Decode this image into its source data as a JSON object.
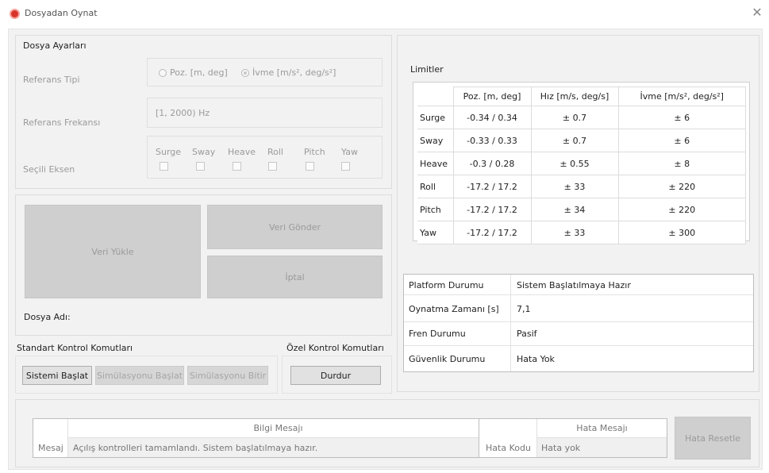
{
  "window": {
    "title": "Dosyadan Oynat",
    "close_glyph": "✕"
  },
  "file_settings": {
    "title": "Dosya Ayarları",
    "reference_type": {
      "label": "Referans Tipi",
      "option_1": "Poz. [m, deg]",
      "option_2": "İvme  [m/s², deg/s²]",
      "selected": "option_2"
    },
    "reference_freq": {
      "label": "Referans Frekansı",
      "value": "[1, 2000) Hz"
    },
    "selected_axis": {
      "label": "Seçili Eksen",
      "axes": [
        "Surge",
        "Sway",
        "Heave",
        "Roll",
        "Pitch",
        "Yaw"
      ]
    }
  },
  "actions": {
    "load": "Veri Yükle",
    "send": "Veri Gönder",
    "cancel": "İptal",
    "file_name_label": "Dosya Adı:"
  },
  "std_commands": {
    "title": "Standart Kontrol Komutları",
    "start_system": "Sistemi Başlat",
    "start_sim": "Simülasyonu Başlat",
    "end_sim": "Simülasyonu Bitir"
  },
  "special_commands": {
    "title": "Özel Kontrol Komutları",
    "stop": "Durdur"
  },
  "limits": {
    "title": "Limitler",
    "headers": [
      "Poz. [m, deg]",
      "Hız [m/s, deg/s]",
      "İvme [m/s², deg/s²]"
    ],
    "rows": [
      {
        "axis": "Surge",
        "pos": "-0.34 / 0.34",
        "vel": "± 0.7",
        "acc": "± 6"
      },
      {
        "axis": "Sway",
        "pos": "-0.33 / 0.33",
        "vel": "± 0.7",
        "acc": "± 6"
      },
      {
        "axis": "Heave",
        "pos": "-0.3 / 0.28",
        "vel": "± 0.55",
        "acc": "± 8"
      },
      {
        "axis": "Roll",
        "pos": "-17.2 / 17.2",
        "vel": "± 33",
        "acc": "± 220"
      },
      {
        "axis": "Pitch",
        "pos": "-17.2 / 17.2",
        "vel": "± 34",
        "acc": "± 220"
      },
      {
        "axis": "Yaw",
        "pos": "-17.2 / 17.2",
        "vel": "± 33",
        "acc": "± 300"
      }
    ]
  },
  "status": {
    "platform": {
      "label": "Platform Durumu",
      "value": "Sistem Başlatılmaya Hazır"
    },
    "play_time": {
      "label": "Oynatma Zamanı [s]",
      "value": "7,1"
    },
    "brake": {
      "label": "Fren Durumu",
      "value": "Pasif"
    },
    "safety": {
      "label": "Güvenlik Durumu",
      "value": "Hata Yok"
    }
  },
  "messages": {
    "info_header": "Bilgi Mesajı",
    "info_label": "Mesaj",
    "info_text": "Açılış kontrolleri tamamlandı. Sistem başlatılmaya hazır.",
    "error_header": "Hata Mesajı",
    "error_code_label": "Hata Kodu",
    "error_text": "Hata yok",
    "reset_button": "Hata Resetle"
  }
}
